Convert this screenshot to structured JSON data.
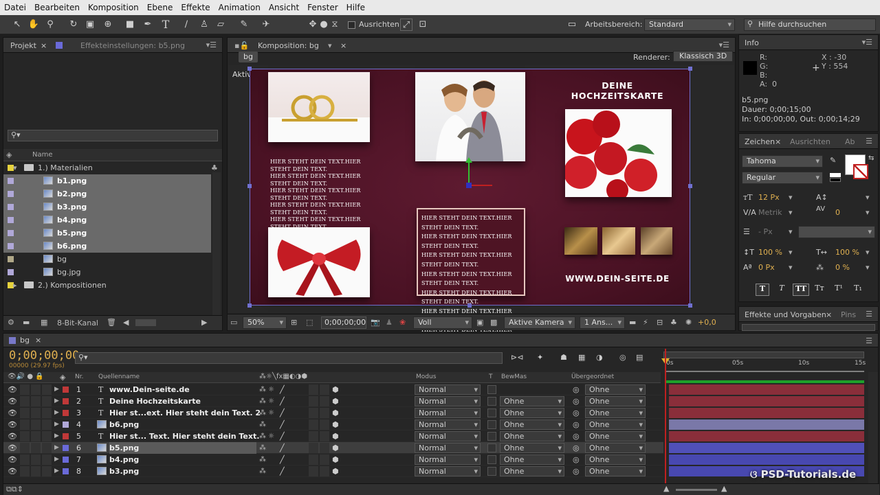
{
  "menu": [
    "Datei",
    "Bearbeiten",
    "Komposition",
    "Ebene",
    "Effekte",
    "Animation",
    "Ansicht",
    "Fenster",
    "Hilfe"
  ],
  "toolbar": {
    "align_label": "Ausrichten",
    "workspace_label": "Arbeitsbereich:",
    "workspace_value": "Standard",
    "help_placeholder": "Hilfe durchsuchen"
  },
  "project": {
    "tab": "Projekt",
    "effects_tab": "Effekteinstellungen: b5.png",
    "name_col": "Name",
    "bit_depth": "8-Bit-Kanal",
    "items": [
      {
        "name": "1.) Materialien",
        "kind": "folder",
        "color": "#e6d23c"
      },
      {
        "name": "b1.png",
        "kind": "png",
        "color": "#b0a8d8"
      },
      {
        "name": "b2.png",
        "kind": "png",
        "color": "#b0a8d8"
      },
      {
        "name": "b3.png",
        "kind": "png",
        "color": "#b0a8d8"
      },
      {
        "name": "b4.png",
        "kind": "png",
        "color": "#b0a8d8"
      },
      {
        "name": "b5.png",
        "kind": "png",
        "color": "#b0a8d8"
      },
      {
        "name": "b6.png",
        "kind": "png",
        "color": "#b0a8d8"
      },
      {
        "name": "bg",
        "kind": "comp",
        "color": "#b0a888"
      },
      {
        "name": "bg.jpg",
        "kind": "jpg",
        "color": "#b0a8d8"
      },
      {
        "name": "2.) Kompositionen",
        "kind": "folder",
        "color": "#e6d23c"
      }
    ]
  },
  "comp": {
    "tab": "Komposition: bg",
    "crumb": "bg",
    "renderer_label": "Renderer:",
    "renderer_value": "Klassisch 3D",
    "camera_label": "Aktive Kamera",
    "card_title": "DEINE HOCHZEITSKARTE",
    "card_url": "WWW.DEIN-SEITE.DE",
    "left_text": [
      "HIER STEHT DEIN TEXT.HIER STEHT DEIN TEXT.",
      "HIER STEHT DEIN TEXT.HIER STEHT DEIN TEXT.",
      "HIER STEHT DEIN TEXT.HIER STEHT DEIN TEXT.",
      "HIER STEHT DEIN TEXT.HIER STEHT DEIN TEXT.",
      "HIER STEHT DEIN TEXT.HIER STEHT DEIN TEXT.",
      "HIER STEHT DEIN TEXT.HIER STEHT DEIN TEXT.",
      "HIER STEHT DEIN TEXT.HIER STEHT DEIN TEXT.",
      "HIER STEHT DEIN TEXT.HIER STEHT DEIN TEXT.",
      "HIER STEHT DEIN TEXT. HIER STEHT DEIN TEXT."
    ],
    "center_text": [
      "HIER STEHT DEIN TEXT.HIER STEHT DEIN TEXT.",
      "HIER STEHT DEIN TEXT.HIER STEHT DEIN TEXT.",
      "HIER STEHT DEIN TEXT.HIER STEHT DEIN TEXT.",
      "HIER STEHT DEIN TEXT.HIER STEHT DEIN TEXT.",
      "HIER STEHT DEIN TEXT.HIER STEHT DEIN TEXT.",
      "HIER STEHT DEIN TEXT.HIER STEHT DEIN TEXT.",
      "HIER STEHT DEIN TEXT.HIER STEHT DEIN TEXT.",
      "HIER STEHT DEIN TEXT.HIER STEHT DEIN TEXT.",
      "HIER STEHT DEIN TEXT.HIER STEHT DEIN TEXT."
    ],
    "zoom": "50%",
    "timecode": "0;00;00;00",
    "quality": "Voll",
    "view": "Aktive Kamera",
    "views": "1 Ans...",
    "exposure": "+0,0"
  },
  "info": {
    "tab": "Info",
    "r": "R:",
    "g": "G:",
    "b": "B:",
    "a": "A:",
    "a_val": "0",
    "x": "X : -30",
    "y": "Y : 554",
    "file": "b5.png",
    "duration": "Dauer: 0;00;15;00",
    "inout": "In: 0;00;00;00, Out: 0;00;14;29"
  },
  "char": {
    "tab": "Zeichen",
    "tab2": "Ausrichten",
    "tab3": "Ab",
    "font": "Tahoma",
    "style": "Regular",
    "size": "12 Px",
    "kerning": "Metrik",
    "tracking": "0",
    "leading": "- Px",
    "vscale": "100 %",
    "hscale": "100 %",
    "baseline": "0 Px",
    "tsume": "0 %"
  },
  "effects": {
    "tab": "Effekte und Vorgaben",
    "tab2": "Pins"
  },
  "timeline": {
    "tab": "bg",
    "timecode": "0;00;00;00",
    "frames": "00000 (29.97 fps)",
    "cols": {
      "nr": "Nr.",
      "source": "Quellenname",
      "mode": "Modus",
      "t": "T",
      "trkmat": "BewMas",
      "parent": "Übergeordnet"
    },
    "ruler": [
      "0s",
      "05s",
      "10s",
      "15s"
    ],
    "layers": [
      {
        "nr": "1",
        "name": "www.Dein-seite.de",
        "type": "T",
        "color": "#c03838",
        "mode": "Normal",
        "trk": "",
        "parent": "Ohne",
        "bar": "#8a2e3a"
      },
      {
        "nr": "2",
        "name": "Deine Hochzeitskarte",
        "type": "T",
        "color": "#c03838",
        "mode": "Normal",
        "trk": "Ohne",
        "parent": "Ohne",
        "bar": "#8a2e3a"
      },
      {
        "nr": "3",
        "name": "Hier st...ext. Hier steht dein Text.  2",
        "type": "T",
        "color": "#c03838",
        "mode": "Normal",
        "trk": "Ohne",
        "parent": "Ohne",
        "bar": "#8a2e3a"
      },
      {
        "nr": "4",
        "name": "b6.png",
        "type": "img",
        "color": "#b0a8d8",
        "mode": "Normal",
        "trk": "Ohne",
        "parent": "Ohne",
        "bar": "#7a78a8"
      },
      {
        "nr": "5",
        "name": "Hier st... Text. Hier steht dein Text.",
        "type": "T",
        "color": "#c03838",
        "mode": "Normal",
        "trk": "Ohne",
        "parent": "Ohne",
        "bar": "#8a2e3a"
      },
      {
        "nr": "6",
        "name": "b5.png",
        "type": "img",
        "color": "#6a6ad8",
        "mode": "Normal",
        "trk": "Ohne",
        "parent": "Ohne",
        "bar": "#5050b8"
      },
      {
        "nr": "7",
        "name": "b4.png",
        "type": "img",
        "color": "#6a6ad8",
        "mode": "Normal",
        "trk": "Ohne",
        "parent": "Ohne",
        "bar": "#4848b0"
      },
      {
        "nr": "8",
        "name": "b3.png",
        "type": "img",
        "color": "#6a6ad8",
        "mode": "Normal",
        "trk": "Ohne",
        "parent": "Ohne",
        "bar": "#4848b0"
      }
    ]
  },
  "watermark": "PSD-Tutorials.de"
}
